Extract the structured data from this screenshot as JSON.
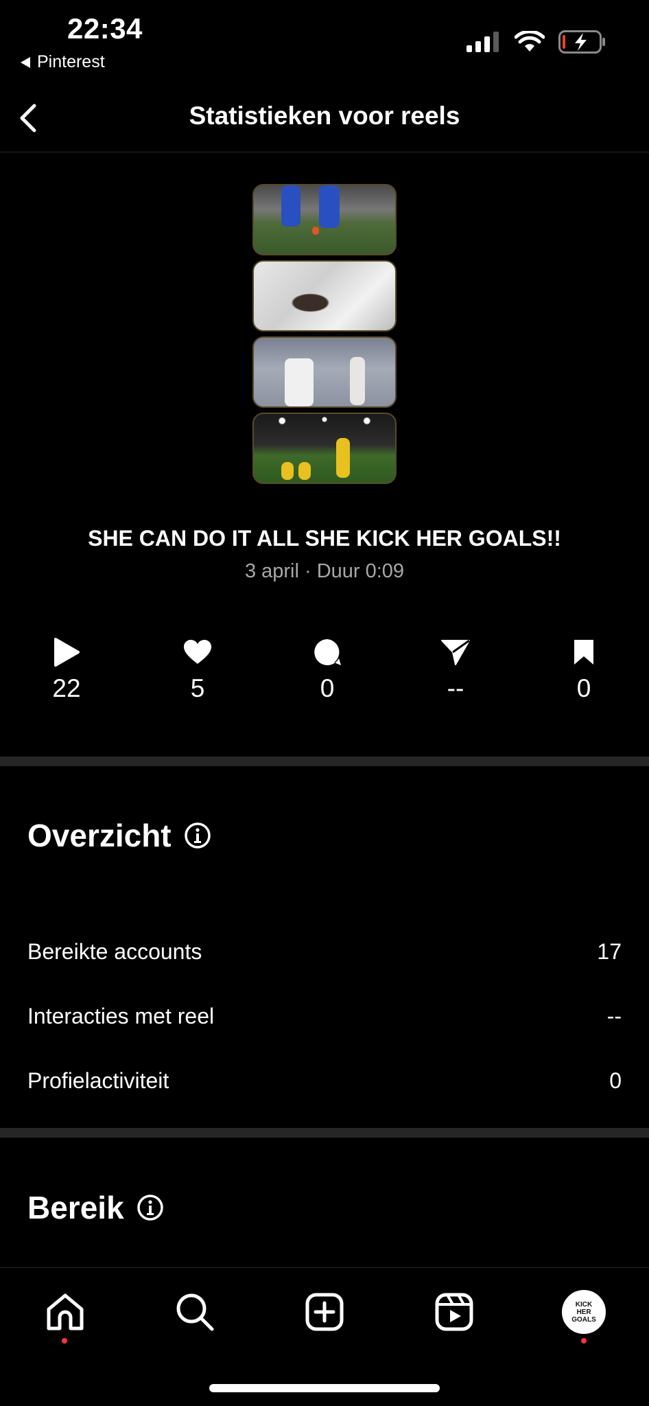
{
  "status_bar": {
    "time": "22:34",
    "back_app": "Pinterest"
  },
  "nav": {
    "title": "Statistieken voor reels"
  },
  "reel": {
    "title": "SHE CAN DO IT ALL SHE KICK HER GOALS!!",
    "meta": "3 april · Duur 0:09"
  },
  "stats": {
    "plays": "22",
    "likes": "5",
    "comments": "0",
    "shares": "--",
    "saves": "0"
  },
  "overview": {
    "title": "Overzicht",
    "rows": [
      {
        "label": "Bereikte accounts",
        "value": "17"
      },
      {
        "label": "Interacties met reel",
        "value": "--"
      },
      {
        "label": "Profielactiviteit",
        "value": "0"
      }
    ]
  },
  "reach": {
    "title": "Bereik"
  },
  "avatar_text": [
    "KICK",
    "HER",
    "GOALS"
  ],
  "colors": {
    "background": "#000000",
    "secondary_text": "#a8a8a8",
    "divider": "#262626",
    "notification_dot": "#ff3040"
  }
}
